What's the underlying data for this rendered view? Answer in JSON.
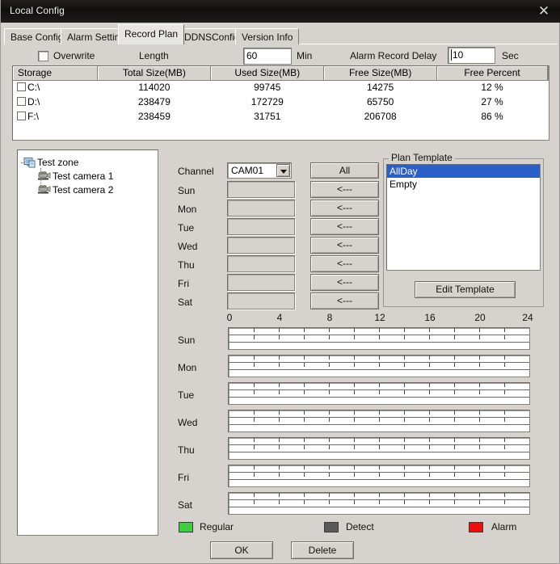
{
  "window": {
    "title": "Local Config",
    "close_icon": "close-icon"
  },
  "tabs": [
    {
      "label": "Base Config",
      "active": false
    },
    {
      "label": "Alarm Setting",
      "active": false
    },
    {
      "label": "Record Plan",
      "active": true
    },
    {
      "label": "DDNSConfig",
      "active": false
    },
    {
      "label": "Version Info",
      "active": false
    }
  ],
  "options": {
    "overwrite_label": "Overwrite",
    "overwrite_checked": false,
    "length_label": "Length",
    "length_value": "60",
    "length_unit": "Min",
    "alarm_delay_label": "Alarm Record Delay",
    "alarm_delay_value": "10",
    "alarm_delay_unit": "Sec"
  },
  "storage_table": {
    "columns": [
      "Storage",
      "Total Size(MB)",
      "Used Size(MB)",
      "Free Size(MB)",
      "Free Percent",
      ""
    ],
    "rows": [
      {
        "drive": "C:\\",
        "checked": false,
        "total": "114020",
        "used": "99745",
        "free": "14275",
        "percent": "12 %"
      },
      {
        "drive": "D:\\",
        "checked": false,
        "total": "238479",
        "used": "172729",
        "free": "65750",
        "percent": "27 %"
      },
      {
        "drive": "F:\\",
        "checked": false,
        "total": "238459",
        "used": "31751",
        "free": "206708",
        "percent": "86 %"
      }
    ]
  },
  "tree": {
    "nodes": [
      {
        "label": "Test zone",
        "icon": "monitor-zone-icon",
        "level": 0
      },
      {
        "label": "Test camera 1",
        "icon": "camera-icon",
        "level": 1
      },
      {
        "label": "Test camera 2",
        "icon": "camera-icon",
        "level": 1
      }
    ]
  },
  "schedule": {
    "channel_label": "Channel",
    "channel_value": "CAM01",
    "channel_options": [
      "CAM01"
    ],
    "all_button": "All",
    "copy_button": "<---",
    "days": [
      "Sun",
      "Mon",
      "Tue",
      "Wed",
      "Thu",
      "Fri",
      "Sat"
    ],
    "day_values": [
      "",
      "",
      "",
      "",
      "",
      "",
      ""
    ]
  },
  "plan_template": {
    "title": "Plan Template",
    "items": [
      {
        "label": "AllDay",
        "selected": true
      },
      {
        "label": "Empty",
        "selected": false
      }
    ],
    "edit_button": "Edit Template"
  },
  "timeline": {
    "hour_labels": [
      "0",
      "4",
      "8",
      "12",
      "16",
      "20",
      "24"
    ],
    "hour_values": [
      0,
      4,
      8,
      12,
      16,
      20,
      24
    ],
    "tick_interval_hours": 2,
    "days": [
      "Sun",
      "Mon",
      "Tue",
      "Wed",
      "Thu",
      "Fri",
      "Sat"
    ],
    "bands_per_day": 3,
    "segments": []
  },
  "legend": [
    {
      "label": "Regular",
      "color": "#3fcc3f"
    },
    {
      "label": "Detect",
      "color": "#595959"
    },
    {
      "label": "Alarm",
      "color": "#f20d0d"
    }
  ],
  "footer": {
    "ok_button": "OK",
    "delete_button": "Delete"
  }
}
